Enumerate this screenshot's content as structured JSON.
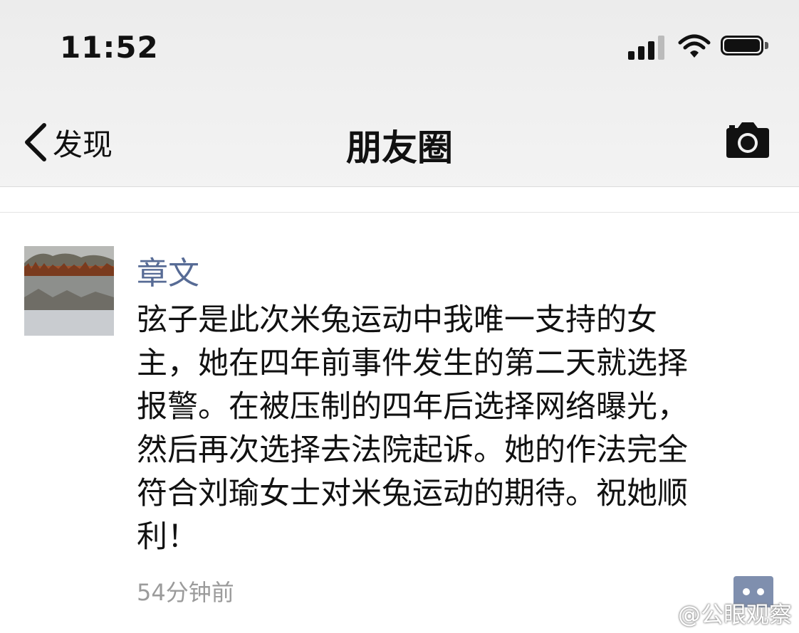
{
  "status_bar": {
    "time": "11:52"
  },
  "nav": {
    "back_label": "发现",
    "title": "朋友圈"
  },
  "post": {
    "author": "章文",
    "lines": [
      "弦子是此次米兔运动中我唯一支持的女",
      "主，她在四年前事件发生的第二天就选择",
      "报警。在被压制的四年后选择网络曝光，",
      "然后再次选择去法院起诉。她的作法完全",
      "符合刘瑜女士对米兔运动的期待。祝她顺",
      "利！"
    ],
    "time_ago": "54分钟前"
  },
  "watermark": {
    "text": "@公眼观察"
  },
  "colors": {
    "author_name": "#576b95",
    "time_ago": "#9b9b9b",
    "comment_button": "#7f8fae"
  },
  "icons": [
    "back-chevron-icon",
    "camera-icon",
    "signal-icon",
    "wifi-icon",
    "battery-icon",
    "comment-icon",
    "weibo-icon"
  ]
}
